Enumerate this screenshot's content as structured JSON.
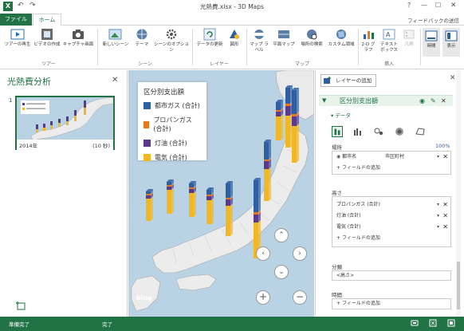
{
  "window": {
    "title": "光熱費.xlsx - 3D Maps",
    "help": "?"
  },
  "tabs": {
    "file": "ファイル",
    "home": "ホーム",
    "feedback": "フィードバックの送信"
  },
  "ribbon": {
    "tour_group": "ツアー",
    "scene_group": "シーン",
    "layer_group": "レイヤー",
    "map_group": "マップ",
    "insert_group": "挿入",
    "play_tour": "ツアーの再生",
    "create_video": "ビデオの作成",
    "capture_screen": "キャプチャ画面",
    "new_scene": "新しいシーン",
    "theme": "テーマ",
    "scene_options": "シーンのオプション",
    "refresh_data": "データの更新",
    "shapes": "図形",
    "map_labels": "マップ ラベル",
    "flat_map": "平面マップ",
    "find_location": "場所の検索",
    "custom_regions": "カスタム領域",
    "chart_2d": "2-D グラフ",
    "text_box": "テキスト ボックス",
    "legend": "凡例",
    "time": "時間",
    "view": "表示"
  },
  "tour_pane": {
    "title": "光熱費分析",
    "scene_number": "1",
    "scene_year": "2014年",
    "scene_duration": "(10 秒)"
  },
  "legend": {
    "title": "区分別支出額",
    "items": [
      {
        "label": "都市ガス (合計)",
        "color": "#2e5fa3"
      },
      {
        "label": "プロパンガス (合計)",
        "color": "#e8781e"
      },
      {
        "label": "灯油 (合計)",
        "color": "#5b3a8c"
      },
      {
        "label": "電気 (合計)",
        "color": "#f2b824"
      }
    ]
  },
  "map": {
    "bing": "bing"
  },
  "layer_pane": {
    "add_layer": "レイヤーの追加",
    "layer_name": "区分別支出額",
    "data_section": "データ",
    "location_section": "場所",
    "location_pct": "100%",
    "location_fields": [
      {
        "name": "都市名",
        "type": "市区町村"
      }
    ],
    "height_section": "高さ",
    "height_fields": [
      "プロパンガス (合計)",
      "灯油 (合計)",
      "電気 (合計)"
    ],
    "add_field": "フィールドの追加",
    "category_section": "分類",
    "category_value": "<高さ>",
    "time_section": "時間"
  },
  "status": {
    "left": "準備完了",
    "center": "完了"
  }
}
